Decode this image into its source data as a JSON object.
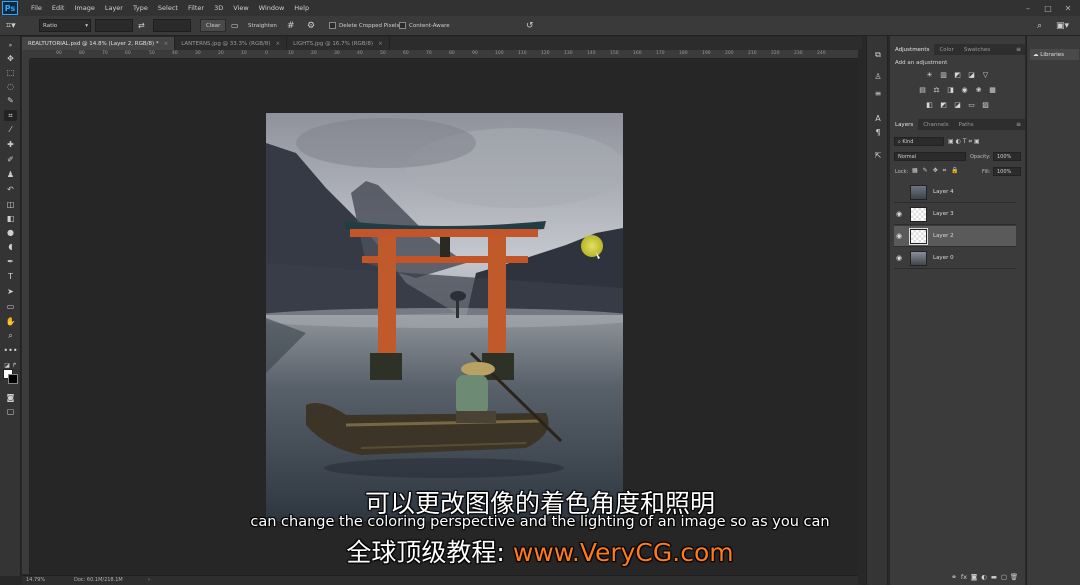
{
  "app": {
    "logo": "Ps"
  },
  "menubar": {
    "items": [
      "File",
      "Edit",
      "Image",
      "Layer",
      "Type",
      "Select",
      "Filter",
      "3D",
      "View",
      "Window",
      "Help"
    ]
  },
  "options_bar": {
    "ratio_label": "Ratio",
    "clear_label": "Clear",
    "straighten_label": "Straighten",
    "delete_cropped_label": "Delete Cropped Pixels",
    "content_aware_label": "Content-Aware"
  },
  "tabs": [
    {
      "label": "REALTUTORIAL.psd @ 14.8% (Layer 2, RGB/8) *",
      "active": true
    },
    {
      "label": "LANTERNS.jpg @ 33.3% (RGB/8)",
      "active": false
    },
    {
      "label": "LIGHTS.jpg @ 16.7% (RGB/8)",
      "active": false
    }
  ],
  "ruler_h": [
    "90",
    "80",
    "70",
    "60",
    "50",
    "40",
    "30",
    "20",
    "10",
    "0",
    "10",
    "20",
    "30",
    "40",
    "50",
    "60",
    "70",
    "80",
    "90",
    "100",
    "110",
    "120",
    "130",
    "140",
    "150",
    "160",
    "170",
    "180",
    "190",
    "200",
    "210",
    "220",
    "230",
    "240"
  ],
  "status": {
    "zoom": "14.79%",
    "doc": "Doc: 60.1M/218.1M"
  },
  "adjustments_panel": {
    "tabs": [
      "Adjustments",
      "Color",
      "Swatches"
    ],
    "title": "Add an adjustment"
  },
  "layers_panel": {
    "tabs": [
      "Layers",
      "Channels",
      "Paths"
    ],
    "filter_label": "Kind",
    "blend_mode": "Normal",
    "opacity_label": "Opacity:",
    "opacity_value": "100%",
    "lock_label": "Lock:",
    "fill_label": "Fill:",
    "fill_value": "100%",
    "layers": [
      {
        "name": "Layer 4",
        "visible": false,
        "selected": false
      },
      {
        "name": "Layer 3",
        "visible": true,
        "selected": false
      },
      {
        "name": "Layer 2",
        "visible": true,
        "selected": true
      },
      {
        "name": "Layer 0",
        "visible": true,
        "selected": false
      }
    ]
  },
  "libraries_panel": {
    "label": "Libraries"
  },
  "subtitles": {
    "chinese": "可以更改图像的着色角度和照明",
    "english": "can change the coloring perspective and the lighting of an image so as you can",
    "brand_cn": "全球顶级教程:",
    "brand_url": "www.VeryCG.com"
  },
  "colors": {
    "accent": "#31a8ff",
    "url_orange": "#ff7a1a"
  }
}
